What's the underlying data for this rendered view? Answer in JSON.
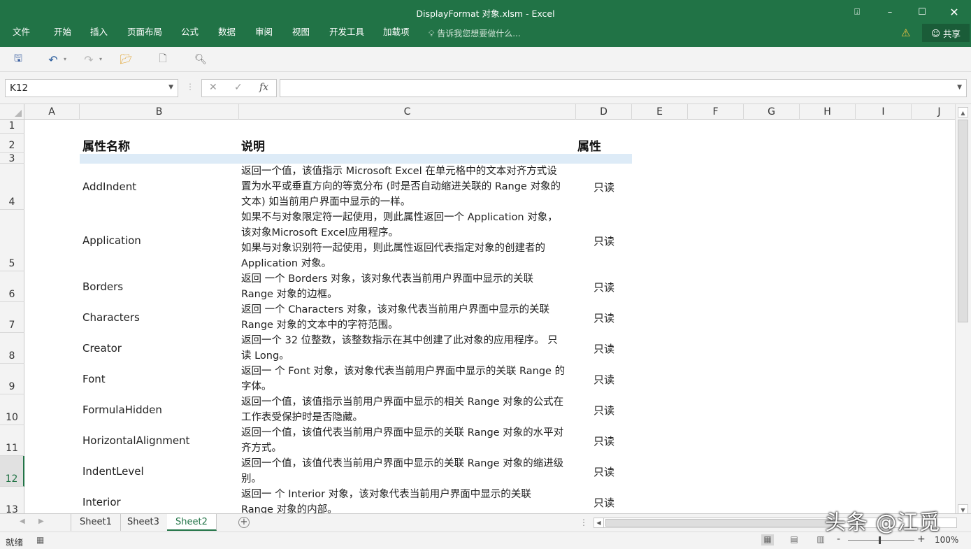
{
  "window": {
    "title": "DisplayFormat 对象.xlsm - Excel"
  },
  "ribbon": {
    "tabs": [
      "文件",
      "开始",
      "插入",
      "页面布局",
      "公式",
      "数据",
      "审阅",
      "视图",
      "开发工具",
      "加载项"
    ],
    "tell_me": "告诉我您想要做什么...",
    "share_label": "共享"
  },
  "formula_bar": {
    "name_box": "K12",
    "fx_label": "fx",
    "content": ""
  },
  "columns": [
    "A",
    "B",
    "C",
    "D",
    "E",
    "F",
    "G",
    "H",
    "I",
    "J"
  ],
  "rows": [
    "1",
    "2",
    "3",
    "4",
    "5",
    "6",
    "7",
    "8",
    "9",
    "10",
    "11",
    "12",
    "13"
  ],
  "table": {
    "headers": {
      "name": "属性名称",
      "description": "说明",
      "property": "属性"
    },
    "items": [
      {
        "name": "AddIndent",
        "desc": [
          "返回一个值，该值指示 Microsoft Excel 在单元格中的文本对齐方式设",
          "置为水平或垂直方向的等宽分布 (时是否自动缩进关联的 Range 对象的",
          "文本) 如当前用户界面中显示的一样。"
        ],
        "prop": "只读"
      },
      {
        "name": "Application",
        "desc": [
          "如果不与对象限定符一起使用，则此属性返回一个 Application 对象，",
          "该对象Microsoft Excel应用程序。",
          "如果与对象识别符一起使用，则此属性返回代表指定对象的创建者的",
          "Application 对象。"
        ],
        "prop": "只读"
      },
      {
        "name": "Borders",
        "desc": [
          "返回 一个 Borders 对象，该对象代表当前用户界面中显示的关联",
          "Range 对象的边框。"
        ],
        "prop": "只读"
      },
      {
        "name": "Characters",
        "desc": [
          "返回 一个 Characters 对象，该对象代表当前用户界面中显示的关联",
          "Range 对象的文本中的字符范围。"
        ],
        "prop": "只读"
      },
      {
        "name": "Creator",
        "desc": [
          "返回一个 32 位整数，该整数指示在其中创建了此对象的应用程序。 只",
          "读 Long。"
        ],
        "prop": "只读"
      },
      {
        "name": "Font",
        "desc": [
          "返回一 个 Font 对象，该对象代表当前用户界面中显示的关联 Range 的",
          "字体。"
        ],
        "prop": "只读"
      },
      {
        "name": "FormulaHidden",
        "desc": [
          "返回一个值，该值指示当前用户界面中显示的相关 Range 对象的公式在",
          "工作表受保护时是否隐藏。"
        ],
        "prop": "只读"
      },
      {
        "name": "HorizontalAlignment",
        "desc": [
          "返回一个值，该值代表当前用户界面中显示的关联 Range 对象的水平对",
          "齐方式。"
        ],
        "prop": "只读"
      },
      {
        "name": "IndentLevel",
        "desc": [
          "返回一个值，该值代表当前用户界面中显示的关联 Range 对象的缩进级",
          "别。"
        ],
        "prop": "只读"
      },
      {
        "name": "Interior",
        "desc": [
          "返回一 个 Interior 对象，该对象代表当前用户界面中显示的关联",
          "Range 对象的内部。"
        ],
        "prop": "只读"
      }
    ]
  },
  "sheets": {
    "tabs": [
      "Sheet1",
      "Sheet3",
      "Sheet2"
    ],
    "active": "Sheet2"
  },
  "status": {
    "ready": "就绪",
    "zoom": "100%",
    "zoom_minus": "-",
    "zoom_plus": "+"
  },
  "watermark": "头条 @江觅",
  "colors": {
    "accent": "#217346",
    "header_band": "#ddebf7"
  }
}
